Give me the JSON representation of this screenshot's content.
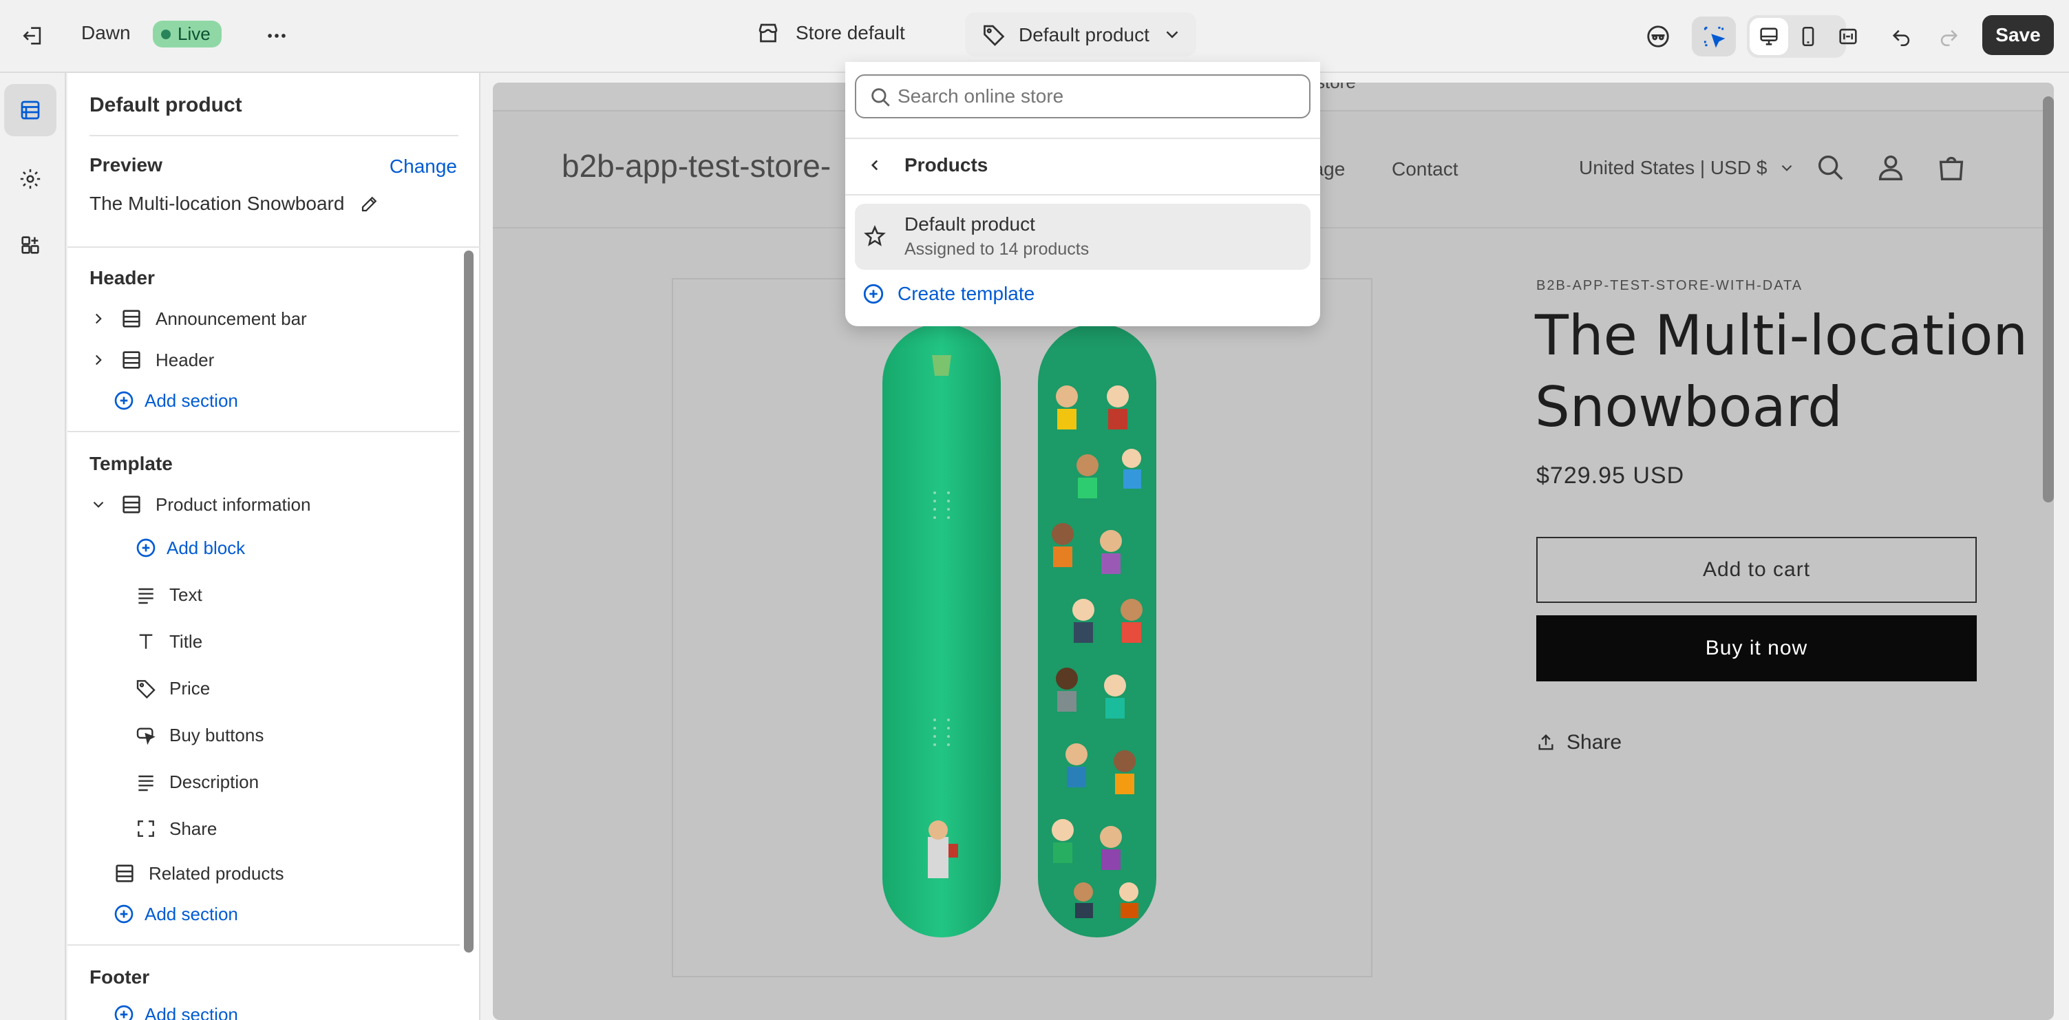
{
  "topbar": {
    "theme_name": "Dawn",
    "live_label": "Live",
    "store_label": "Store default",
    "template_label": "Default product",
    "save_label": "Save"
  },
  "sidebar": {
    "title": "Default product",
    "preview_label": "Preview",
    "change_label": "Change",
    "preview_product": "The Multi-location Snowboard",
    "header_group": "Header",
    "header_items": [
      "Announcement bar",
      "Header"
    ],
    "add_section": "Add section",
    "template_group": "Template",
    "product_information": "Product information",
    "add_block": "Add block",
    "blocks": [
      "Text",
      "Title",
      "Price",
      "Buy buttons",
      "Description",
      "Share"
    ],
    "related_products": "Related products",
    "footer_group": "Footer"
  },
  "dropdown": {
    "search_placeholder": "Search online store",
    "back_label": "Products",
    "item_title": "Default product",
    "item_subtitle": "Assigned to 14 products",
    "create_label": "Create template"
  },
  "store": {
    "top_partial": "store",
    "logo_partial": "b2b-app-test-store-",
    "nav_partial": "page",
    "nav_contact": "Contact",
    "currency": "United States | USD $",
    "vendor": "B2B-APP-TEST-STORE-WITH-DATA",
    "product_title_line1": "The Multi-location",
    "product_title_line2": "Snowboard",
    "price": "$729.95 USD",
    "add_to_cart": "Add to cart",
    "buy_now": "Buy it now",
    "share": "Share"
  },
  "colors": {
    "accent": "#005bd3",
    "live_bg": "#8fd8a5",
    "board_green": "#1fbf7e",
    "board_dark": "#1c9a67"
  }
}
